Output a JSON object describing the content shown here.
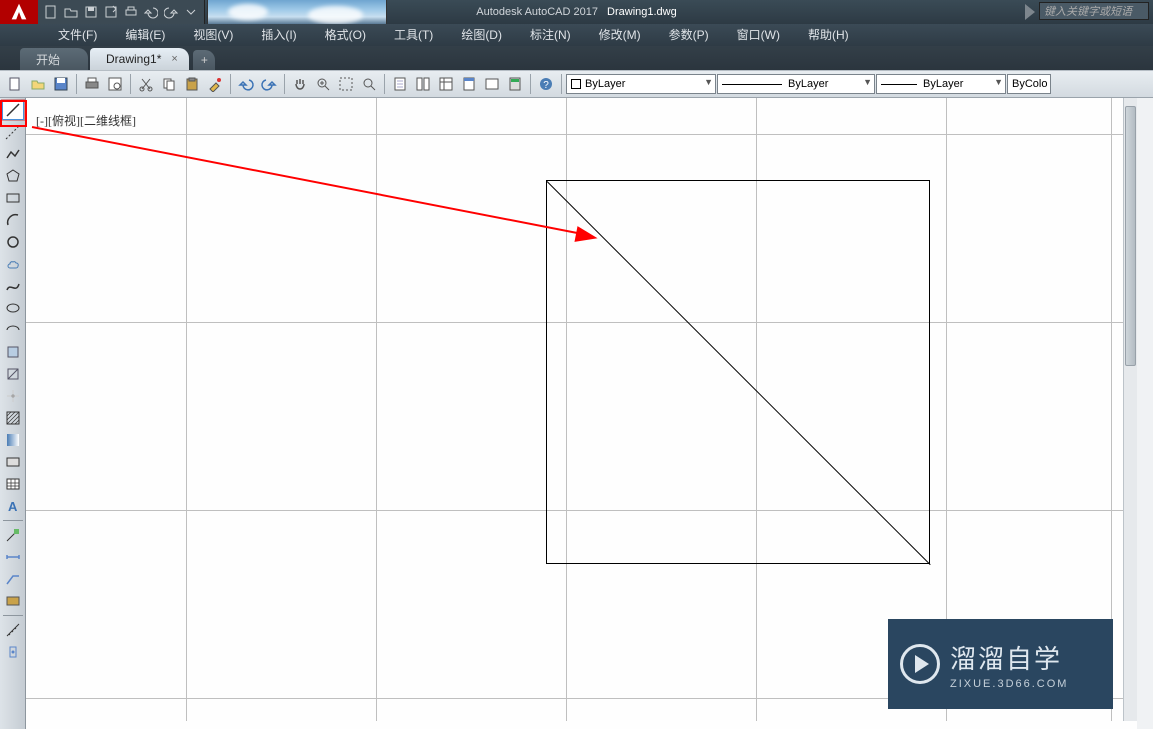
{
  "title": {
    "app": "Autodesk AutoCAD 2017",
    "file": "Drawing1.dwg"
  },
  "searchPlaceholder": "键入关键字或短语",
  "menu": [
    {
      "label": "文件(F)"
    },
    {
      "label": "编辑(E)"
    },
    {
      "label": "视图(V)"
    },
    {
      "label": "插入(I)"
    },
    {
      "label": "格式(O)"
    },
    {
      "label": "工具(T)"
    },
    {
      "label": "绘图(D)"
    },
    {
      "label": "标注(N)"
    },
    {
      "label": "修改(M)"
    },
    {
      "label": "参数(P)"
    },
    {
      "label": "窗口(W)"
    },
    {
      "label": "帮助(H)"
    }
  ],
  "tabs": {
    "start": "开始",
    "active": "Drawing1*",
    "add": "+"
  },
  "layers": {
    "current": "ByLayer",
    "linetype": "ByLayer",
    "lineweight": "ByLayer",
    "color": "ByColo"
  },
  "viewport": "[-][俯视][二维线框]",
  "watermark": {
    "big": "溜溜自学",
    "small": "ZIXUE.3D66.COM"
  }
}
